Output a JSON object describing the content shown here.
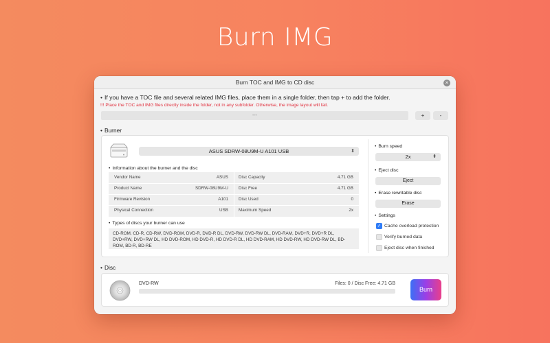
{
  "hero": {
    "title": "Burn IMG"
  },
  "window": {
    "title": "Burn TOC and IMG to CD disc",
    "intro": "If you have a TOC file and several related IMG files, place them in a single folder, then tap + to add the folder.",
    "warning": "!!! Place the TOC and IMG files directly inside the folder, not in any subfolder. Otherwise, the image layout will fail.",
    "folder_placeholder": "---",
    "add_label": "+",
    "remove_label": "-"
  },
  "burner": {
    "section_label": "Burner",
    "selected_drive": "ASUS SDRW-08U9M-U A101 USB",
    "info_heading": "Information about the burner and the disc",
    "info_left": [
      {
        "label": "Vendor Name",
        "value": "ASUS"
      },
      {
        "label": "Product Name",
        "value": "SDRW-08U9M-U"
      },
      {
        "label": "Firmware Revision",
        "value": "A101"
      },
      {
        "label": "Physical Connection",
        "value": "USB"
      }
    ],
    "info_right": [
      {
        "label": "Disc Capacity",
        "value": "4.71 GB"
      },
      {
        "label": "Disc Free",
        "value": "4.71 GB"
      },
      {
        "label": "Disc Used",
        "value": "0"
      },
      {
        "label": "Maximum Speed",
        "value": "2x"
      }
    ],
    "types_heading": "Types of discs your burner can use",
    "types_text": "CD-ROM, CD-R, CD-RW, DVD-ROM, DVD-R, DVD-R DL, DVD-RW, DVD-RW DL, DVD-RAM, DVD+R, DVD+R DL, DVD+RW, DVD+RW DL, HD DVD-ROM, HD DVD-R, HD DVD-R DL, HD DVD-RAM, HD DVD-RW, HD DVD-RW DL, BD-ROM, BD-R, BD-RE"
  },
  "options": {
    "burn_speed_label": "Burn speed",
    "burn_speed_value": "2x",
    "eject_label": "Eject disc",
    "eject_button": "Eject",
    "erase_label": "Erase rewritable disc",
    "erase_button": "Erase",
    "settings_label": "Settings",
    "settings": [
      {
        "label": "Cache overload protection",
        "checked": true
      },
      {
        "label": "Verify burned data",
        "checked": false
      },
      {
        "label": "Eject disc when finished",
        "checked": false
      }
    ]
  },
  "disc": {
    "section_label": "Disc",
    "type": "DVD-RW",
    "status": "Files: 0 / Disc Free: 4.71 GB",
    "progress": 0,
    "burn_button": "Burn"
  },
  "colors": {
    "accent": "#2f7cf6",
    "warning": "#e0303e",
    "background_from": "#f48b5f",
    "background_to": "#f7735e"
  }
}
